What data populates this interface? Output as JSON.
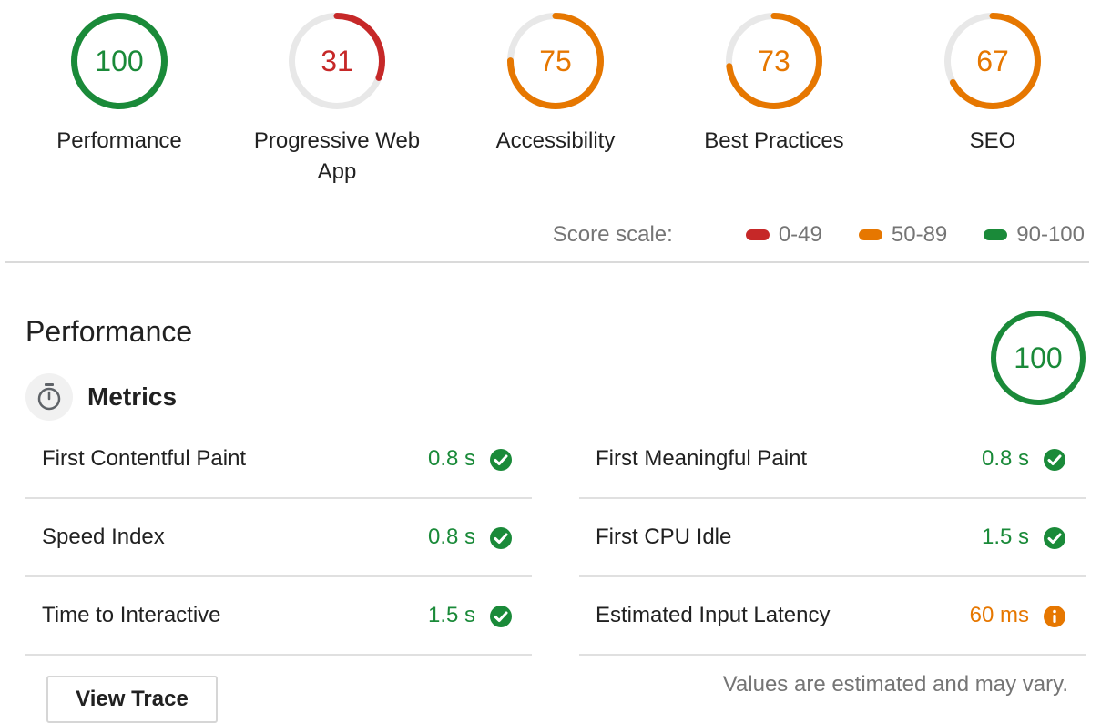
{
  "colors": {
    "pass": "#1a8a39",
    "average": "#e67700",
    "fail": "#c62828",
    "track": "#e8e8e8"
  },
  "gauges": [
    {
      "label": "Performance",
      "value": "100",
      "score": 100,
      "status": "pass"
    },
    {
      "label": "Progressive Web App",
      "value": "31",
      "score": 31,
      "status": "fail"
    },
    {
      "label": "Accessibility",
      "value": "75",
      "score": 75,
      "status": "average"
    },
    {
      "label": "Best Practices",
      "value": "73",
      "score": 73,
      "status": "average"
    },
    {
      "label": "SEO",
      "value": "67",
      "score": 67,
      "status": "average"
    }
  ],
  "score_scale": {
    "title": "Score scale:",
    "items": [
      {
        "label": "0-49",
        "status": "fail"
      },
      {
        "label": "50-89",
        "status": "average"
      },
      {
        "label": "90-100",
        "status": "pass"
      }
    ]
  },
  "performance_section": {
    "title": "Performance",
    "score": "100",
    "score_value": 100,
    "metrics_title": "Metrics",
    "metrics_icon": "stopwatch-icon",
    "metrics": [
      {
        "name": "First Contentful Paint",
        "value": "0.8 s",
        "status": "pass",
        "icon": "check-circle-icon"
      },
      {
        "name": "First Meaningful Paint",
        "value": "0.8 s",
        "status": "pass",
        "icon": "check-circle-icon"
      },
      {
        "name": "Speed Index",
        "value": "0.8 s",
        "status": "pass",
        "icon": "check-circle-icon"
      },
      {
        "name": "First CPU Idle",
        "value": "1.5 s",
        "status": "pass",
        "icon": "check-circle-icon"
      },
      {
        "name": "Time to Interactive",
        "value": "1.5 s",
        "status": "pass",
        "icon": "check-circle-icon"
      },
      {
        "name": "Estimated Input Latency",
        "value": "60 ms",
        "status": "average",
        "icon": "info-circle-icon"
      }
    ],
    "view_trace_label": "View Trace",
    "note": "Values are estimated and may vary."
  }
}
